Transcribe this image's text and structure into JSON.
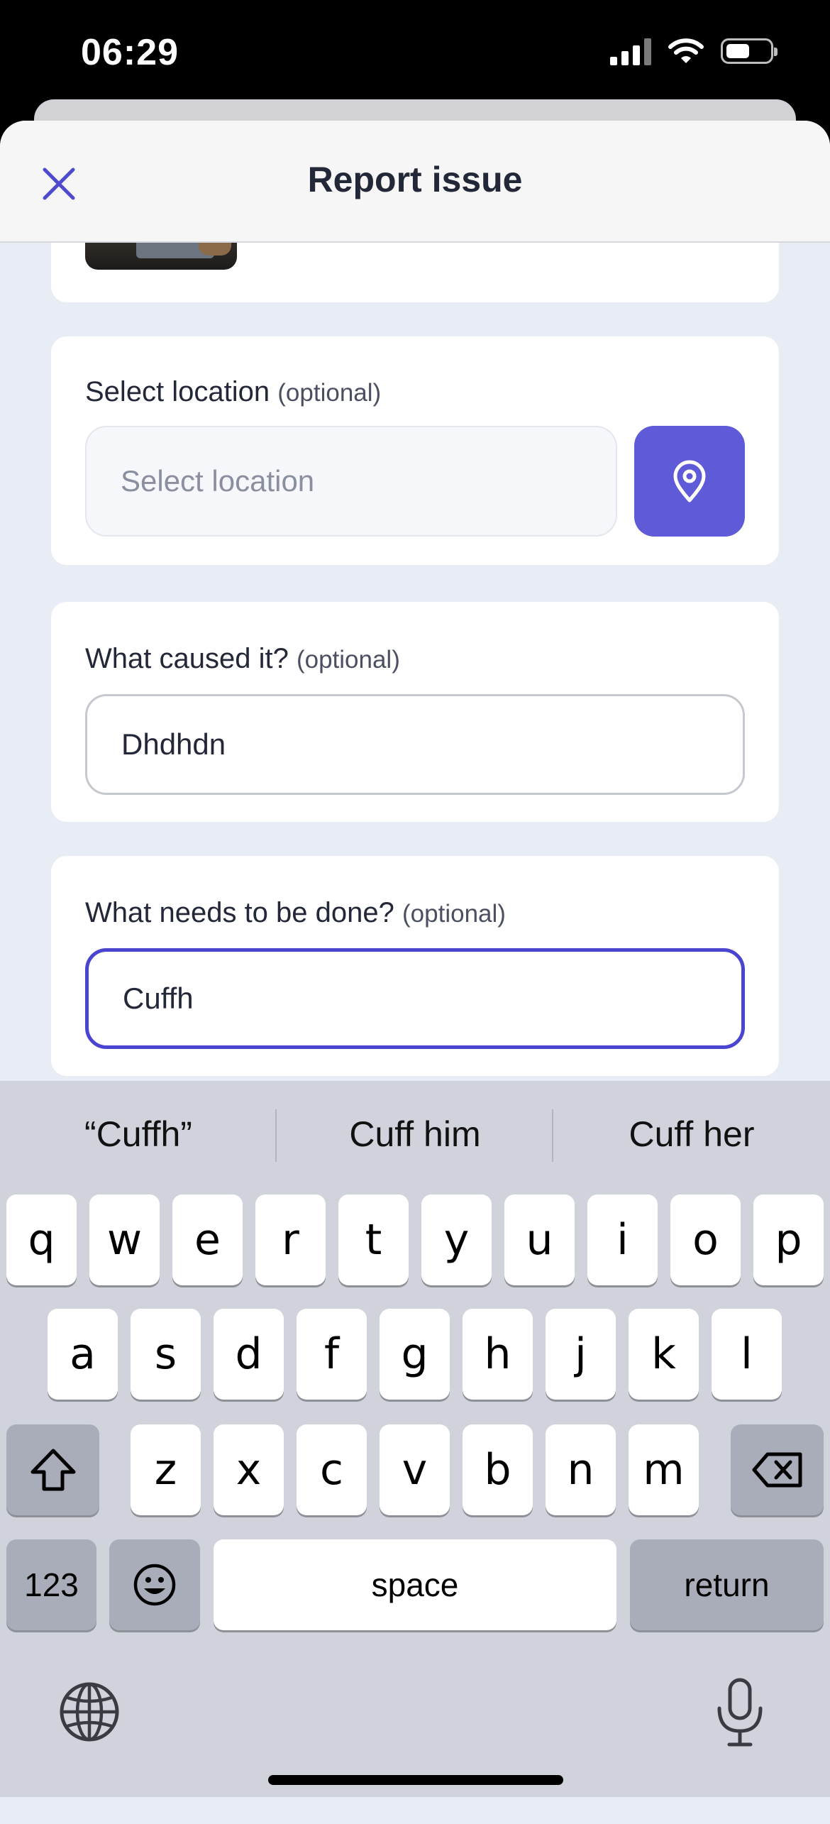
{
  "status_bar": {
    "time": "06:29"
  },
  "header": {
    "title": "Report issue"
  },
  "location": {
    "label": "Select location",
    "optional": "(optional)",
    "placeholder": "Select location"
  },
  "cause": {
    "label": "What caused it?",
    "optional": "(optional)",
    "value": "Dhdhdn"
  },
  "todo": {
    "label": "What needs to be done?",
    "optional": "(optional)",
    "value": "Cuffh"
  },
  "keyboard": {
    "suggestions": [
      "“Cuffh”",
      "Cuff him",
      "Cuff her"
    ],
    "row1": [
      "q",
      "w",
      "e",
      "r",
      "t",
      "y",
      "u",
      "i",
      "o",
      "p"
    ],
    "row2": [
      "a",
      "s",
      "d",
      "f",
      "g",
      "h",
      "j",
      "k",
      "l"
    ],
    "row3": [
      "z",
      "x",
      "c",
      "v",
      "b",
      "n",
      "m"
    ],
    "numbers_label": "123",
    "space_label": "space",
    "return_label": "return"
  },
  "colors": {
    "accent": "#5e5ad8",
    "focus_border": "#4a44d0"
  }
}
